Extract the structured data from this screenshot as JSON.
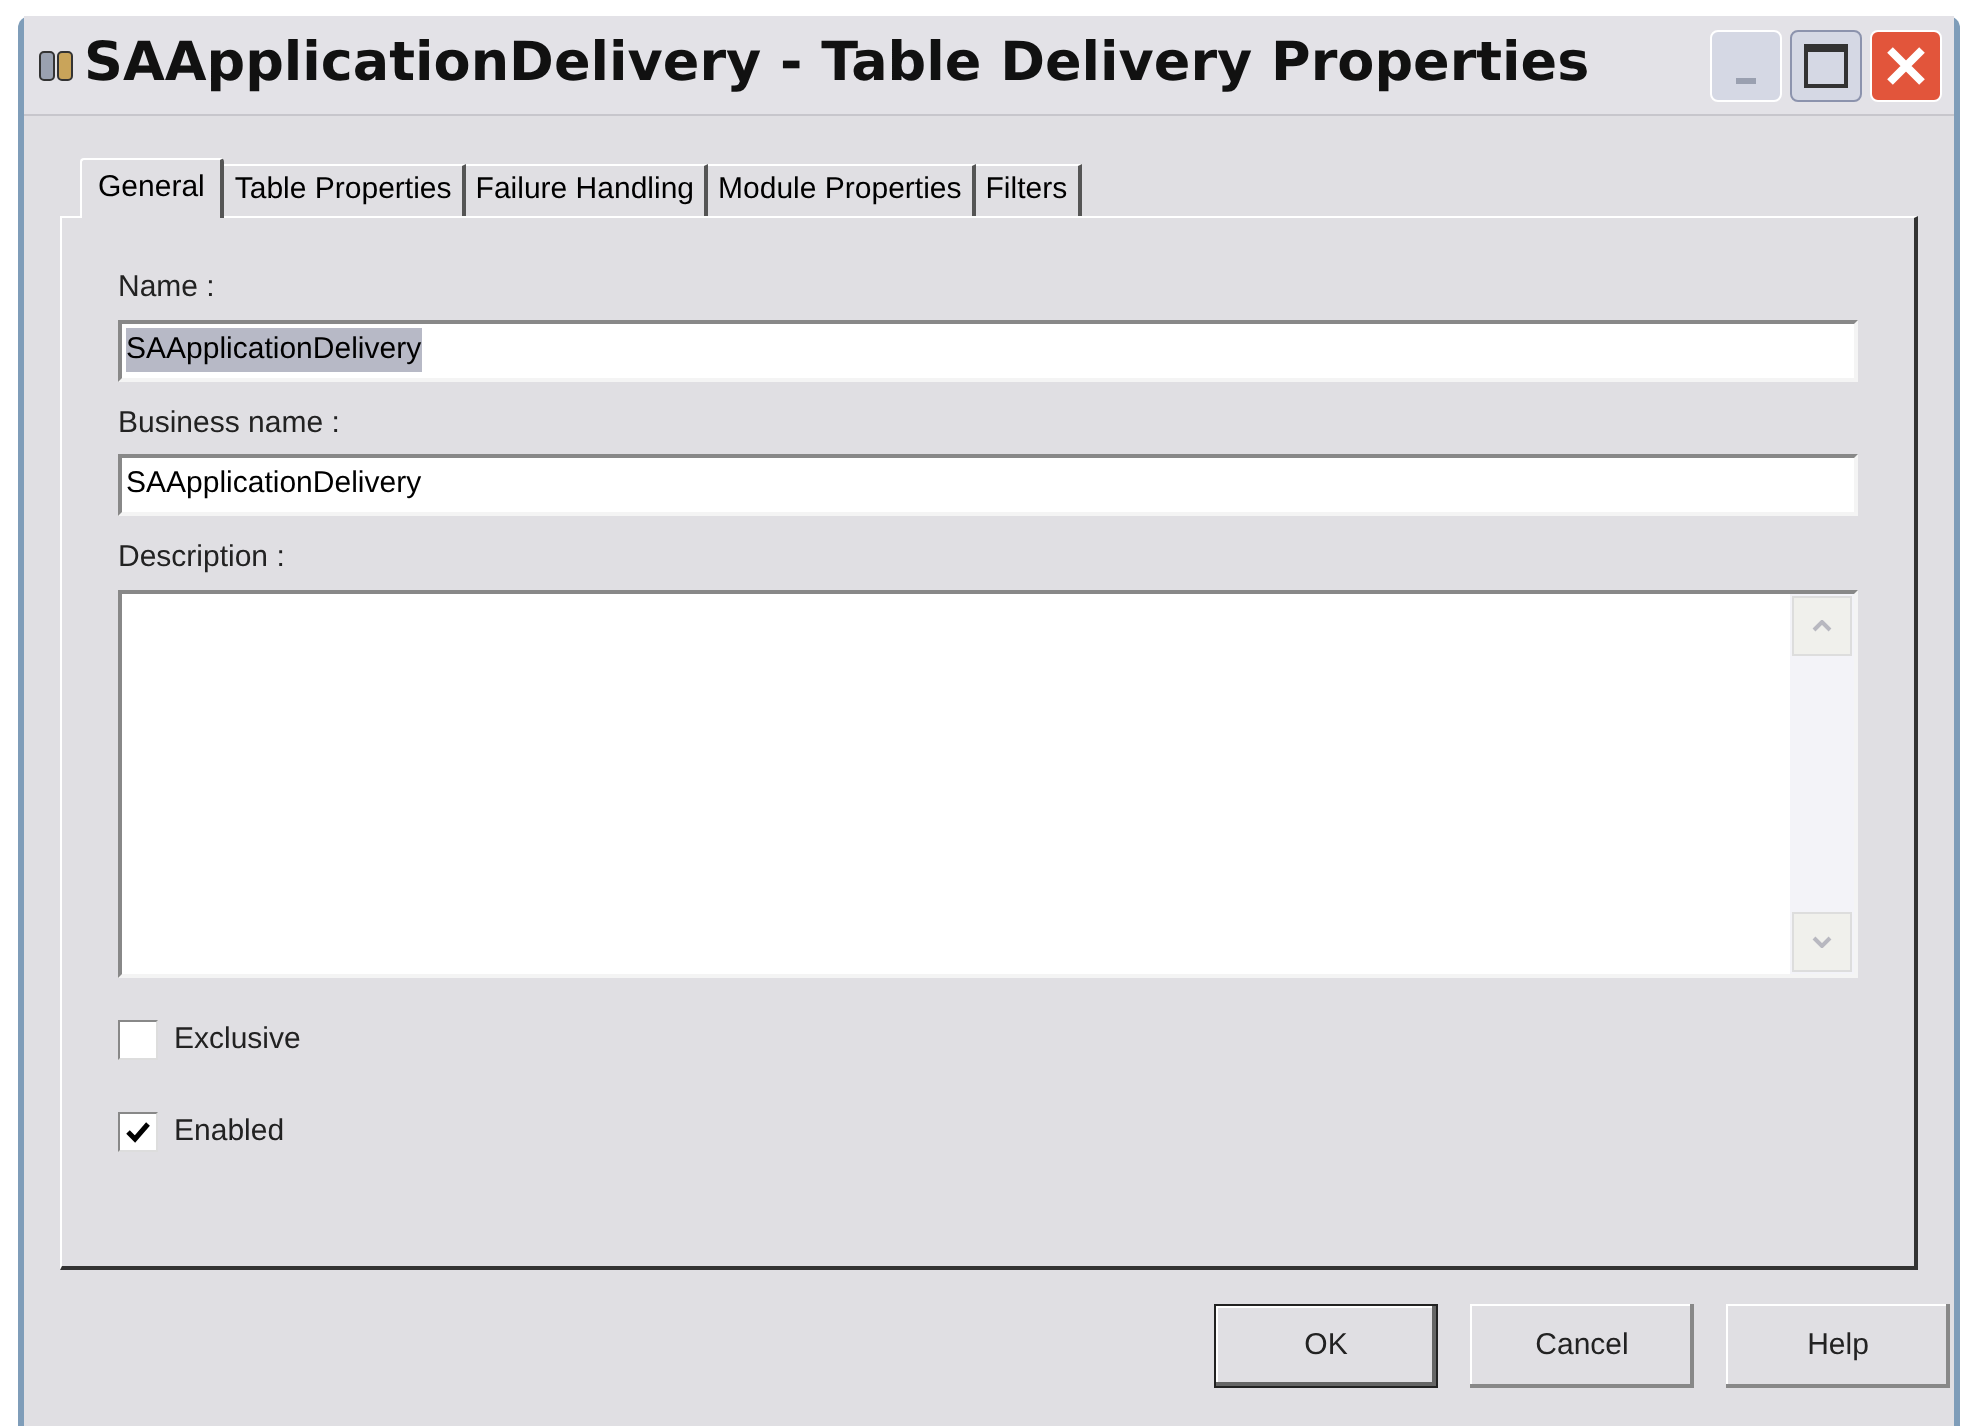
{
  "window": {
    "title": "SAApplicationDelivery - Table Delivery Properties"
  },
  "tabs": [
    {
      "label": "General",
      "selected": true
    },
    {
      "label": "Table Properties",
      "selected": false
    },
    {
      "label": "Failure Handling",
      "selected": false
    },
    {
      "label": "Module Properties",
      "selected": false
    },
    {
      "label": "Filters",
      "selected": false
    }
  ],
  "fields": [
    {
      "label": "Name :",
      "value": "SAApplicationDelivery",
      "selected": true
    },
    {
      "label": "Business name :",
      "value": "SAApplicationDelivery",
      "selected": false
    }
  ],
  "description": {
    "label": "Description :"
  },
  "checkboxes": [
    {
      "label": "Exclusive",
      "checked": false
    },
    {
      "label": "Enabled",
      "checked": true
    }
  ],
  "buttons": [
    {
      "label": "OK",
      "default": true
    },
    {
      "label": "Cancel",
      "default": false
    },
    {
      "label": "Help",
      "default": false
    }
  ]
}
